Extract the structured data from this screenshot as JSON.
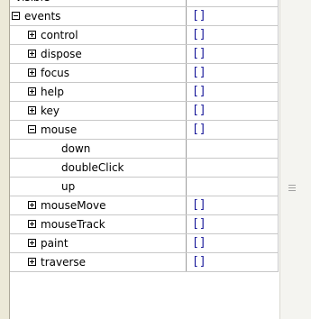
{
  "rows": [
    {
      "name": "visible",
      "value": "true",
      "expander": "none",
      "indent": 0
    },
    {
      "name": "events",
      "value": "[]",
      "expander": "minus",
      "indent": 0
    },
    {
      "name": "control",
      "value": "[]",
      "expander": "plus",
      "indent": 1
    },
    {
      "name": "dispose",
      "value": "[]",
      "expander": "plus",
      "indent": 1
    },
    {
      "name": "focus",
      "value": "[]",
      "expander": "plus",
      "indent": 1
    },
    {
      "name": "help",
      "value": "[]",
      "expander": "plus",
      "indent": 1
    },
    {
      "name": "key",
      "value": "[]",
      "expander": "plus",
      "indent": 1
    },
    {
      "name": "mouse",
      "value": "[]",
      "expander": "minus",
      "indent": 1
    },
    {
      "name": "down",
      "value": "",
      "expander": "none",
      "indent": 2
    },
    {
      "name": "doubleClick",
      "value": "",
      "expander": "none",
      "indent": 2
    },
    {
      "name": "up",
      "value": "",
      "expander": "none",
      "indent": 2
    },
    {
      "name": "mouseMove",
      "value": "[]",
      "expander": "plus",
      "indent": 1
    },
    {
      "name": "mouseTrack",
      "value": "[]",
      "expander": "plus",
      "indent": 1
    },
    {
      "name": "paint",
      "value": "[]",
      "expander": "plus",
      "indent": 1
    },
    {
      "name": "traverse",
      "value": "[]",
      "expander": "plus",
      "indent": 1
    }
  ],
  "colors": {
    "value_text": "#1a1a9a",
    "grid_line": "#c8c8c8",
    "frame": "#ece9d8"
  }
}
